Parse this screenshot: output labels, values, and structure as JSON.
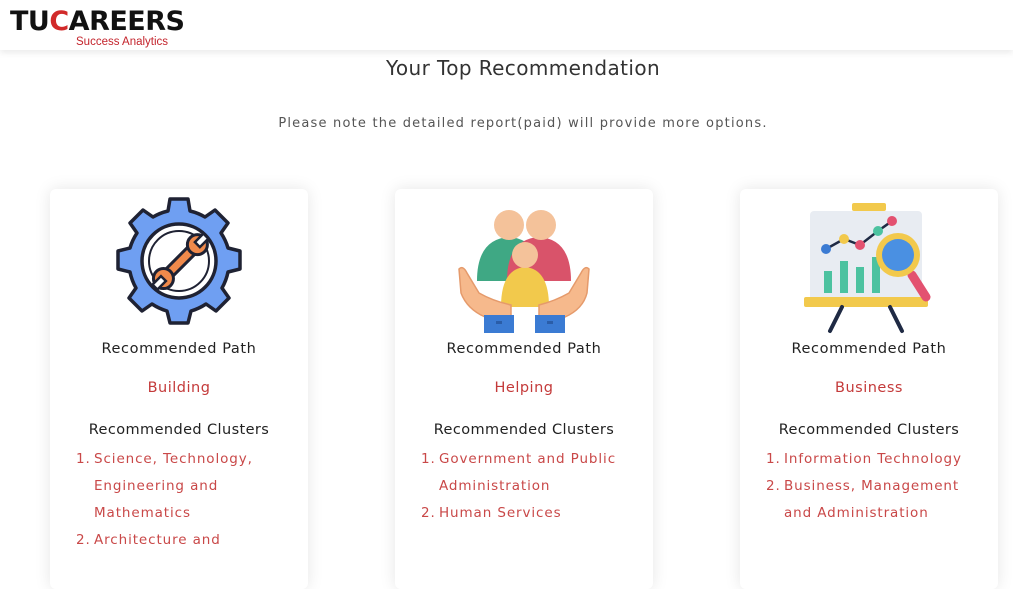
{
  "header": {
    "logo": {
      "brand_part1": "TU",
      "brand_accent": "C",
      "brand_part2": "AREERS",
      "tagline": "Success Analytics"
    }
  },
  "main": {
    "title": "Your Top Recommendation",
    "note": "Please note the detailed report(paid) will provide more options."
  },
  "cards": [
    {
      "icon": "gear-wrench-icon",
      "path_label": "Recommended Path",
      "path_value": "Building",
      "clusters_label": "Recommended Clusters",
      "clusters": [
        "Science, Technology, Engineering and Mathematics",
        "Architecture and"
      ]
    },
    {
      "icon": "family-hands-icon",
      "path_label": "Recommended Path",
      "path_value": "Helping",
      "clusters_label": "Recommended Clusters",
      "clusters": [
        "Government and Public Administration",
        "Human Services"
      ]
    },
    {
      "icon": "analytics-board-icon",
      "path_label": "Recommended Path",
      "path_value": "Business",
      "clusters_label": "Recommended Clusters",
      "clusters": [
        "Information Technology",
        "Business, Management and Administration"
      ]
    }
  ],
  "colors": {
    "accent_red": "#c94848",
    "text_dark": "#222222",
    "card_bg": "#ffffff"
  }
}
